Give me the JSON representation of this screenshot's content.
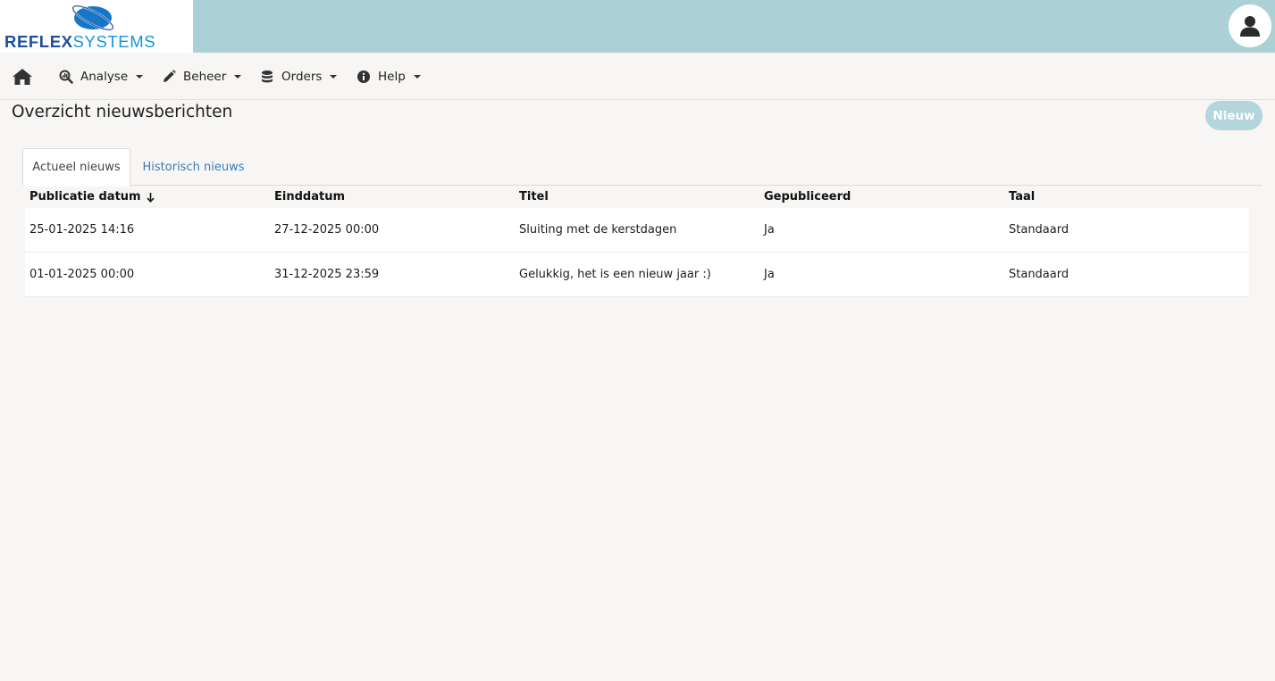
{
  "app": {
    "logo_text_bold": "REFLEX",
    "logo_text_light": "SYSTEMS"
  },
  "colors": {
    "topbar": "#abd1d7",
    "accent_button": "#b2d6dc",
    "link": "#3a7bb8",
    "logo_dark_blue": "#1c4fa0",
    "logo_light_blue": "#1496d6"
  },
  "nav": {
    "home_icon": "home-icon",
    "items": [
      {
        "label": "Analyse",
        "icon": "analysis-search-icon"
      },
      {
        "label": "Beheer",
        "icon": "pencil-icon"
      },
      {
        "label": "Orders",
        "icon": "database-icon"
      },
      {
        "label": "Help",
        "icon": "info-circle-icon"
      }
    ]
  },
  "page": {
    "title": "Overzicht nieuwsberichten",
    "new_button": "Nieuw"
  },
  "tabs": [
    {
      "label": "Actueel nieuws",
      "active": true
    },
    {
      "label": "Historisch nieuws",
      "active": false
    }
  ],
  "table": {
    "columns": [
      "Publicatie datum",
      "Einddatum",
      "Titel",
      "Gepubliceerd",
      "Taal"
    ],
    "sort": {
      "column": "Publicatie datum",
      "direction": "descending"
    },
    "rows": [
      [
        "25-01-2025 14:16",
        "27-12-2025 00:00",
        "Sluiting met de kerstdagen",
        "Ja",
        "Standaard"
      ],
      [
        "01-01-2025 00:00",
        "31-12-2025 23:59",
        "Gelukkig, het is een nieuw jaar :)",
        "Ja",
        "Standaard"
      ]
    ]
  }
}
